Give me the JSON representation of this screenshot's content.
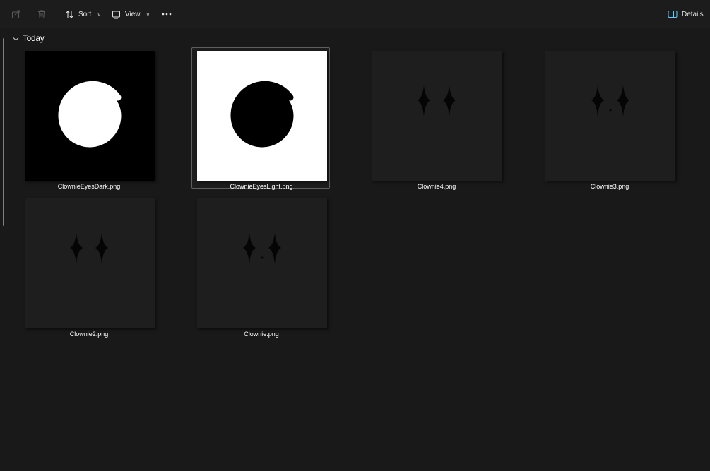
{
  "toolbar": {
    "sort_label": "Sort",
    "view_label": "View",
    "details_label": "Details",
    "accent_color": "#60cdff"
  },
  "group": {
    "label": "Today"
  },
  "files": [
    {
      "name": "ClownieEyesDark.png",
      "thumb": "spiral-white-on-black",
      "selected": false
    },
    {
      "name": "ClownieEyesLight.png",
      "thumb": "spiral-black-on-white",
      "selected": true
    },
    {
      "name": "Clownie4.png",
      "thumb": "two-star-eyes",
      "selected": false
    },
    {
      "name": "Clownie3.png",
      "thumb": "two-star-eyes-dot",
      "selected": false
    },
    {
      "name": "Clownie2.png",
      "thumb": "two-star-eyes",
      "selected": false
    },
    {
      "name": "Clownie.png",
      "thumb": "two-star-eyes-dot",
      "selected": false
    }
  ]
}
